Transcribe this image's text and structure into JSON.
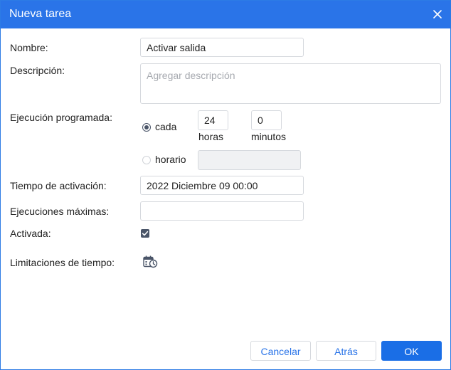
{
  "dialog": {
    "title": "Nueva tarea",
    "close_icon": "close-icon"
  },
  "form": {
    "name_label": "Nombre:",
    "name_value": "Activar salida",
    "description_label": "Descripción:",
    "description_placeholder": "Agregar descripción",
    "schedule_label": "Ejecución programada:",
    "every_label": "cada",
    "hours_value": "24",
    "hours_unit": "horas",
    "minutes_value": "0",
    "minutes_unit": "minutos",
    "schedule_label_option": "horario",
    "schedule_value": "",
    "activation_time_label": "Tiempo de activación:",
    "activation_time_value": "2022 Diciembre 09 00:00",
    "max_runs_label": "Ejecuciones máximas:",
    "max_runs_value": "",
    "enabled_label": "Activada:",
    "enabled": true,
    "time_limits_label": "Limitaciones de tiempo:",
    "time_limits_icon": "calendar-clock-icon",
    "selected_mode": "cada"
  },
  "footer": {
    "cancel_label": "Cancelar",
    "back_label": "Atrás",
    "ok_label": "OK"
  },
  "colors": {
    "accent": "#2a74e8",
    "primary_button": "#1a6ee6"
  }
}
